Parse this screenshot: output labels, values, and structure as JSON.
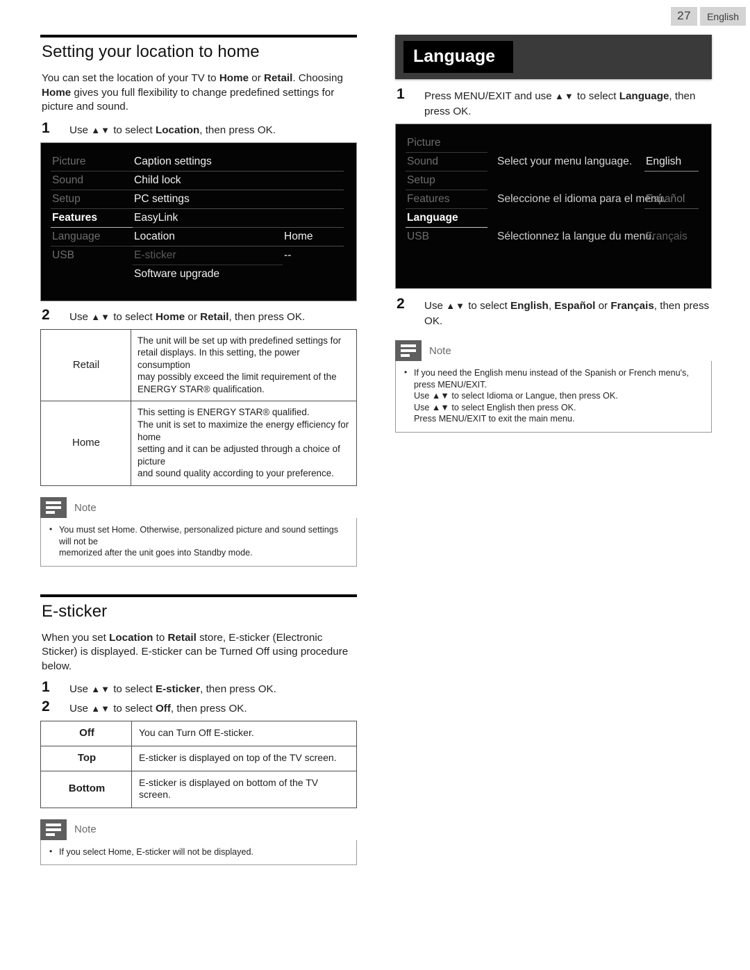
{
  "header": {
    "page_number": "27",
    "language_tag": "English"
  },
  "left": {
    "section1": {
      "title": "Setting your location to home",
      "intro_1": "You can set the location of your TV to ",
      "intro_b1": "Home",
      "intro_2": " or ",
      "intro_b2": "Retail",
      "intro_3": ". Choosing ",
      "intro_b3": "Home",
      "intro_4": " gives you full flexibility to change predefined settings for picture and sound.",
      "step1_num": "1",
      "step1_a": "Use ",
      "step1_arrows": "▲▼",
      "step1_b": " to select ",
      "step1_bold": "Location",
      "step1_c": ", then press OK.",
      "step2_num": "2",
      "step2_a": "Use ",
      "step2_arrows": "▲▼",
      "step2_b": " to select ",
      "step2_bold1": "Home",
      "step2_c": " or ",
      "step2_bold2": "Retail",
      "step2_d": ", then press OK."
    },
    "tv_menu": {
      "side_items": [
        "Picture",
        "Sound",
        "Setup",
        "Features",
        "Language",
        "USB"
      ],
      "selected_side": "Features",
      "menu_items": [
        "Caption settings",
        "Child lock",
        "PC settings",
        "EasyLink",
        "Location",
        "E-sticker",
        "Software upgrade"
      ],
      "disabled_menu_item": "E-sticker",
      "values": [
        "",
        "",
        "",
        "",
        "Home",
        "--",
        ""
      ]
    },
    "location_table": {
      "rows": [
        {
          "label": "Retail",
          "lines": [
            "The unit will be set up with predefined settings for",
            "retail displays. In this setting, the power consumption",
            "may possibly exceed the limit requirement of the",
            "ENERGY STAR® qualification."
          ]
        },
        {
          "label": "Home",
          "lines": [
            "This setting is ENERGY STAR® qualified.",
            "The unit is set to maximize the energy efficiency for home",
            "setting and it can be adjusted through a choice of picture",
            "and sound quality according to your preference."
          ]
        }
      ]
    },
    "note1": {
      "label": "Note",
      "lines": [
        "You must set Home. Otherwise, personalized picture and sound settings will not be",
        "memorized after the unit goes into Standby mode."
      ]
    },
    "section2": {
      "title": "E-sticker",
      "intro_1": "When you set ",
      "intro_b1": "Location",
      "intro_2": " to ",
      "intro_b2": "Retail",
      "intro_3": " store, E-sticker (Electronic Sticker) is displayed. E-sticker can be Turned Off using procedure below.",
      "step1_num": "1",
      "step1_a": "Use ",
      "step1_arrows": "▲▼",
      "step1_b": " to select ",
      "step1_bold": "E-sticker",
      "step1_c": ", then press OK.",
      "step2_num": "2",
      "step2_a": "Use ",
      "step2_arrows": "▲▼",
      "step2_b": " to select ",
      "step2_bold": "Off",
      "step2_c": ", then press OK."
    },
    "esticker_table": {
      "rows": [
        {
          "label": "Off",
          "desc": "You can Turn Off E-sticker."
        },
        {
          "label": "Top",
          "desc": "E-sticker is displayed on top of the TV screen."
        },
        {
          "label": "Bottom",
          "desc": "E-sticker is displayed on bottom of the TV screen."
        }
      ]
    },
    "note2": {
      "label": "Note",
      "lines": [
        "If you select Home, E-sticker will not be displayed."
      ]
    }
  },
  "right": {
    "banner_title": "Language",
    "step1_num": "1",
    "step1_a": "Press MENU/EXIT and use ",
    "step1_arrows": "▲▼",
    "step1_b": " to select ",
    "step1_bold": "Language",
    "step1_c": ", then press OK.",
    "step2_num": "2",
    "step2_a": "Use ",
    "step2_arrows": "▲▼",
    "step2_b": " to select ",
    "step2_bold1": "English",
    "step2_c": ", ",
    "step2_bold2": "Español",
    "step2_d": " or ",
    "step2_bold3": "Français",
    "step2_e": ", then press OK.",
    "tv_menu": {
      "side_items": [
        "Picture",
        "Sound",
        "Setup",
        "Features",
        "Language",
        "USB"
      ],
      "selected_side": "Language",
      "descriptions": [
        "Select your menu language.",
        "Seleccione el idioma para el menú.",
        "Sélectionnez la langue du menu."
      ],
      "values": [
        "English",
        "Español",
        "Français"
      ],
      "selected_value": "English"
    },
    "note": {
      "label": "Note",
      "lines": [
        "If you need the English menu instead of the Spanish or French menu's, press MENU/EXIT.",
        "Use ▲▼ to select Idioma or Langue, then press OK.",
        "Use ▲▼ to select English then press OK.",
        "Press MENU/EXIT to exit the main menu."
      ]
    }
  }
}
